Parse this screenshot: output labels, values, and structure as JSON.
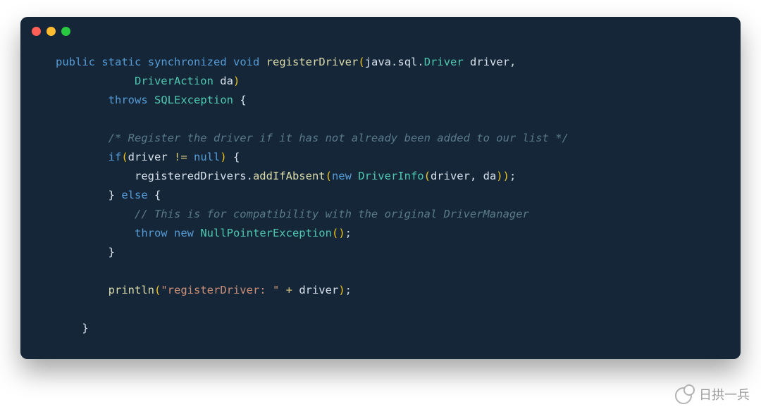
{
  "window": {
    "dots": [
      "red",
      "yellow",
      "green"
    ]
  },
  "code": {
    "L1": {
      "kw_public": "public",
      "kw_static": "static",
      "kw_synchronized": "synchronized",
      "kw_void": "void",
      "meth": "registerDriver",
      "paren_open": "(",
      "pkg": "java",
      "dot1": ".",
      "sub": "sql",
      "dot2": ".",
      "type": "Driver",
      "param1": " driver",
      "comma": ","
    },
    "L2": {
      "indent": "            ",
      "type": "DriverAction",
      "param2": " da",
      "paren_close": ")"
    },
    "L3": {
      "indent": "        ",
      "kw_throws": "throws",
      "type": "SQLException",
      "brace": " {"
    },
    "L4": {
      "indent": ""
    },
    "L5": {
      "indent": "        ",
      "comment": "/* Register the driver if it has not already been added to our list */"
    },
    "L6": {
      "indent": "        ",
      "kw_if": "if",
      "paren_open": "(",
      "var": "driver",
      "op": " != ",
      "kw_null": "null",
      "paren_close": ")",
      "brace": " {"
    },
    "L7": {
      "indent": "            ",
      "obj": "registeredDrivers",
      "dot": ".",
      "meth": "addIfAbsent",
      "paren_open": "(",
      "kw_new": "new",
      "type": " DriverInfo",
      "paren_open2": "(",
      "args": "driver, da",
      "paren_close2": ")",
      "paren_close": ")",
      "semi": ";"
    },
    "L8": {
      "indent": "        ",
      "brace_close": "}",
      "kw_else": " else ",
      "brace_open": "{"
    },
    "L9": {
      "indent": "            ",
      "comment": "// This is for compatibility with the original DriverManager"
    },
    "L10": {
      "indent": "            ",
      "kw_throw": "throw",
      "kw_new": " new ",
      "type": "NullPointerException",
      "paren_open": "(",
      "paren_close": ")",
      "semi": ";"
    },
    "L11": {
      "indent": "        ",
      "brace_close": "}"
    },
    "L12": {
      "indent": ""
    },
    "L13": {
      "indent": "        ",
      "meth": "println",
      "paren_open": "(",
      "str": "\"registerDriver: \"",
      "plus": " + ",
      "var": "driver",
      "paren_close": ")",
      "semi": ";"
    },
    "L14": {
      "indent": ""
    },
    "L15": {
      "indent": "    ",
      "brace_close": "}"
    }
  },
  "watermark": {
    "text": "日拱一兵"
  }
}
